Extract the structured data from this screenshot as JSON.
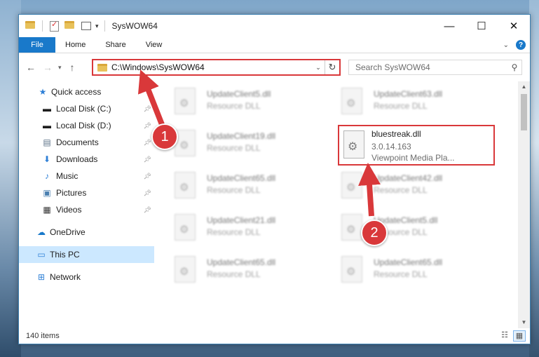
{
  "window": {
    "title": "SysWOW64",
    "controls": {
      "minimize": "—",
      "maximize": "☐",
      "close": "✕"
    }
  },
  "ribbon": {
    "file_tab": "File",
    "tabs": [
      "Home",
      "Share",
      "View"
    ],
    "help": "?"
  },
  "address": {
    "path": "C:\\Windows\\SysWOW64",
    "search_placeholder": "Search SysWOW64"
  },
  "nav": {
    "quick_access": "Quick access",
    "items": [
      {
        "label": "Local Disk (C:)",
        "icon": "drive-icon"
      },
      {
        "label": "Local Disk (D:)",
        "icon": "drive-icon"
      },
      {
        "label": "Documents",
        "icon": "documents-icon"
      },
      {
        "label": "Downloads",
        "icon": "downloads-icon"
      },
      {
        "label": "Music",
        "icon": "music-icon"
      },
      {
        "label": "Pictures",
        "icon": "pictures-icon"
      },
      {
        "label": "Videos",
        "icon": "videos-icon"
      }
    ],
    "onedrive": "OneDrive",
    "this_pc": "This PC",
    "network": "Network"
  },
  "files": {
    "left_column": [
      {
        "name": "UpdateClient5.dll",
        "type": "Resource DLL"
      },
      {
        "name": "UpdateClient19.dll",
        "type": "Resource DLL"
      },
      {
        "name": "UpdateClient65.dll",
        "type": "Resource DLL"
      },
      {
        "name": "UpdateClient21.dll",
        "type": "Resource DLL"
      },
      {
        "name": "UpdateClient65.dll",
        "type": "Resource DLL"
      }
    ],
    "right_column": [
      {
        "name": "UpdateClient63.dll",
        "type": "Resource DLL"
      },
      {
        "name": "UpdateClient42.dll",
        "type": "Resource DLL"
      },
      {
        "name": "UpdateClient5.dll",
        "type": "Resource DLL"
      },
      {
        "name": "UpdateClient65.dll",
        "type": "Resource DLL"
      }
    ],
    "selected": {
      "name": "bluestreak.dll",
      "version": "3.0.14.163",
      "company": "Viewpoint Media Pla..."
    }
  },
  "status": {
    "count": "140 items"
  },
  "callouts": [
    "1",
    "2"
  ],
  "colors": {
    "accent": "#1979ca",
    "callout": "#d9383a",
    "selection": "#cce8ff"
  }
}
